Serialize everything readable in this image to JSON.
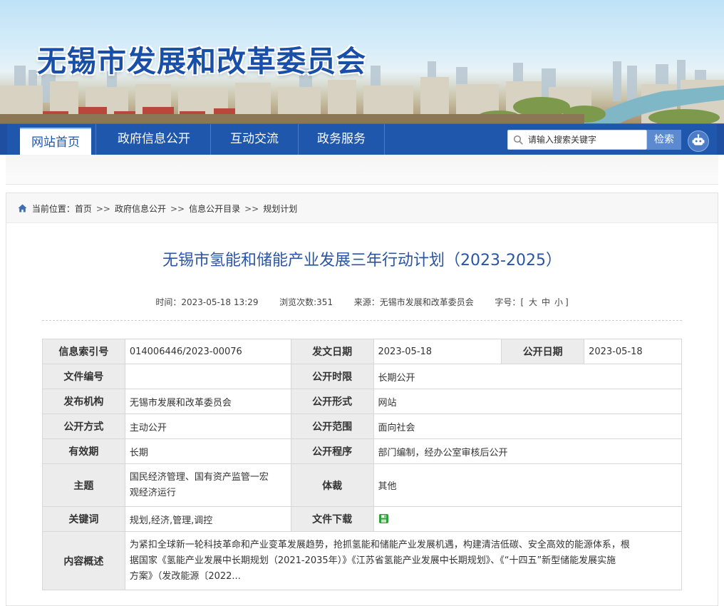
{
  "site": {
    "title": "无锡市发展和改革委员会"
  },
  "nav": {
    "items": [
      {
        "label": "网站首页",
        "active": true
      },
      {
        "label": "政府信息公开",
        "active": false
      },
      {
        "label": "互动交流",
        "active": false
      },
      {
        "label": "政务服务",
        "active": false
      }
    ],
    "search": {
      "placeholder": "请输入搜索关键字",
      "button": "检索"
    }
  },
  "breadcrumb": {
    "prefix": "当前位置：",
    "items": [
      "首页",
      "政府信息公开",
      "信息公开目录",
      "规划计划"
    ],
    "separator": ">>"
  },
  "article": {
    "title": "无锡市氢能和储能产业发展三年行动计划（2023-2025）",
    "meta": {
      "time_label": "时间：",
      "time": "2023-05-18 13:29",
      "views_label": "浏览次数:",
      "views": "351",
      "source_label": "来源：",
      "source": "无锡市发展和改革委员会",
      "fontsize_label": "字号：",
      "fontsize_open": "[",
      "fontsize_options": [
        "大",
        "中",
        "小"
      ],
      "fontsize_close": "]"
    }
  },
  "info_table": {
    "index_no_label": "信息索引号",
    "index_no": "014006446/2023-00076",
    "issue_date_label": "发文日期",
    "issue_date": "2023-05-18",
    "public_date_label": "公开日期",
    "public_date": "2023-05-18",
    "doc_no_label": "文件编号",
    "doc_no": "",
    "public_term_label": "公开时限",
    "public_term": "长期公开",
    "publisher_label": "发布机构",
    "publisher": "无锡市发展和改革委员会",
    "public_form_label": "公开形式",
    "public_form": "网站",
    "public_method_label": "公开方式",
    "public_method": "主动公开",
    "public_scope_label": "公开范围",
    "public_scope": "面向社会",
    "validity_label": "有效期",
    "validity": "长期",
    "public_procedure_label": "公开程序",
    "public_procedure": "部门编制，经办公室审核后公开",
    "topic_label": "主题",
    "topic_line1": "国民经济管理、国有资产监管一宏",
    "topic_line2": "观经济运行",
    "genre_label": "体裁",
    "genre": "其他",
    "keywords_label": "关键词",
    "keywords": "规划,经济,管理,调控",
    "download_label": "文件下载",
    "summary_label": "内容概述",
    "summary_line1": "为紧扣全球新一轮科技革命和产业变革发展趋势，抢抓氢能和储能产业发展机遇，构建清洁低碳、安全高效的能源体系，根",
    "summary_line2": "据国家《氢能产业发展中长期规划（2021-2035年）》《江苏省氢能产业发展中长期规划》、《“十四五”新型储能发展实施",
    "summary_line3": "方案》（发改能源〔2022..."
  },
  "colors": {
    "nav_bg": "#1f57ad",
    "title_blue": "#2a54a4",
    "label_bg": "#ececec",
    "download_green": "#2e9e3e"
  }
}
